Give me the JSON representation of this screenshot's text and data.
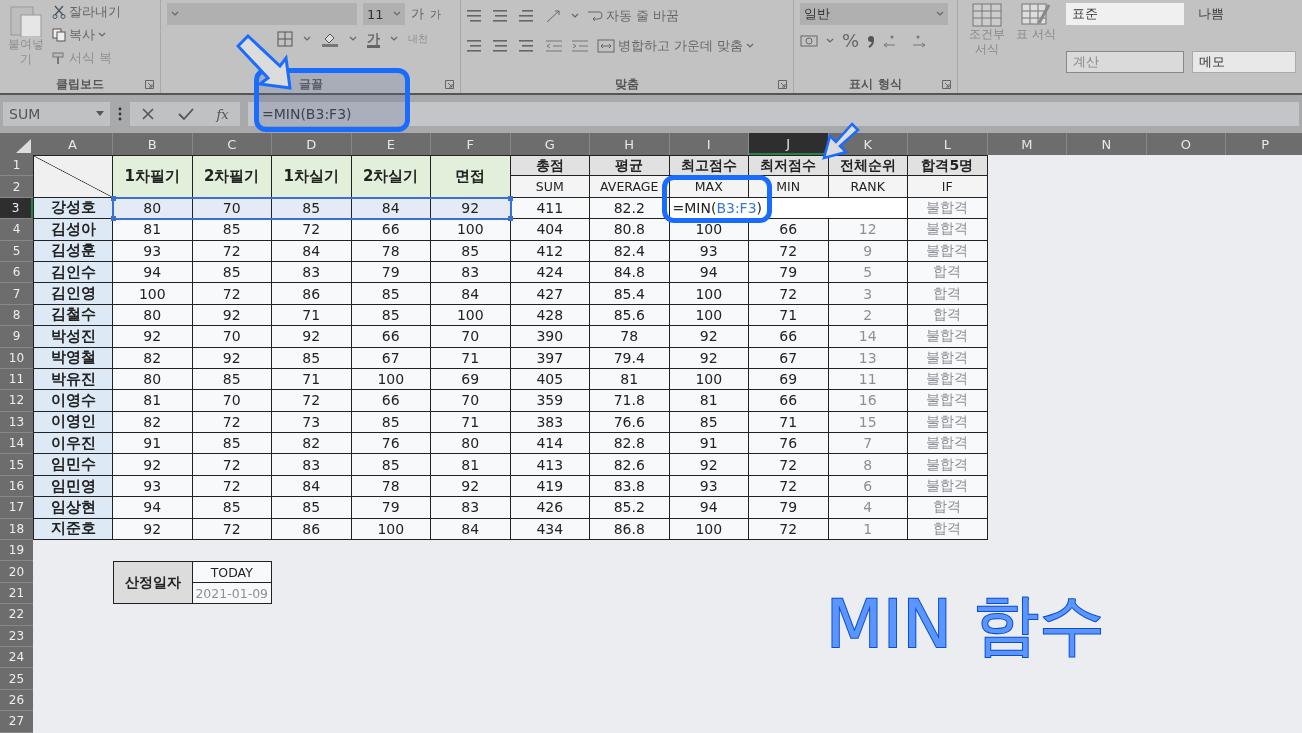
{
  "ribbon": {
    "clipboard": {
      "label": "클립보드",
      "paste": "붙여넣기",
      "cut": "잘라내기",
      "copy": "복사",
      "format_painter": "서식 복"
    },
    "font": {
      "label": "글꼴",
      "size": "11",
      "grow": "가",
      "shrink": "가",
      "font_color": "가",
      "phonetic": "내천"
    },
    "alignment": {
      "label": "맞춤",
      "wrap": "자동 줄 바꿈",
      "merge": "병합하고 가운데 맞춤"
    },
    "number": {
      "label": "표시 형식",
      "format": "일반",
      "percent": "%"
    },
    "styles": {
      "conditional": "조건부 서식",
      "table": "표 서식",
      "cell_styles": [
        {
          "label": "표준",
          "kind": "normal"
        },
        {
          "label": "나쁨",
          "kind": "bad"
        },
        {
          "label": "계산",
          "kind": "calculation"
        },
        {
          "label": "메모",
          "kind": "note"
        }
      ]
    }
  },
  "formula_bar": {
    "name_box": "SUM",
    "function_label": "fx",
    "formula": "=MIN(B3:F3)"
  },
  "columns": [
    {
      "label": "A",
      "selected": false
    },
    {
      "label": "B",
      "selected": false
    },
    {
      "label": "C",
      "selected": false
    },
    {
      "label": "D",
      "selected": false
    },
    {
      "label": "E",
      "selected": false
    },
    {
      "label": "F",
      "selected": false
    },
    {
      "label": "G",
      "selected": false
    },
    {
      "label": "H",
      "selected": false
    },
    {
      "label": "I",
      "selected": false
    },
    {
      "label": "J",
      "selected": true
    },
    {
      "label": "K",
      "selected": false
    },
    {
      "label": "L",
      "selected": false
    },
    {
      "label": "M",
      "selected": false
    },
    {
      "label": "N",
      "selected": false
    },
    {
      "label": "O",
      "selected": false
    },
    {
      "label": "P",
      "selected": false
    }
  ],
  "rows": [
    {
      "label": "1",
      "selected": false
    },
    {
      "label": "2",
      "selected": false
    },
    {
      "label": "3",
      "selected": true
    },
    {
      "label": "4",
      "selected": false
    },
    {
      "label": "5",
      "selected": false
    },
    {
      "label": "6",
      "selected": false
    },
    {
      "label": "7",
      "selected": false
    },
    {
      "label": "8",
      "selected": false
    },
    {
      "label": "9",
      "selected": false
    },
    {
      "label": "10",
      "selected": false
    },
    {
      "label": "11",
      "selected": false
    },
    {
      "label": "12",
      "selected": false
    },
    {
      "label": "13",
      "selected": false
    },
    {
      "label": "14",
      "selected": false
    },
    {
      "label": "15",
      "selected": false
    },
    {
      "label": "16",
      "selected": false
    },
    {
      "label": "17",
      "selected": false
    },
    {
      "label": "18",
      "selected": false
    },
    {
      "label": "19",
      "selected": false
    },
    {
      "label": "20",
      "selected": false
    },
    {
      "label": "21",
      "selected": false
    },
    {
      "label": "22",
      "selected": false
    },
    {
      "label": "23",
      "selected": false
    },
    {
      "label": "24",
      "selected": false
    },
    {
      "label": "25",
      "selected": false
    },
    {
      "label": "26",
      "selected": false
    },
    {
      "label": "27",
      "selected": false
    }
  ],
  "table": {
    "subjects": [
      "1차필기",
      "2차필기",
      "1차실기",
      "2차실기",
      "면접"
    ],
    "summary": [
      {
        "title": "총점",
        "function": "SUM"
      },
      {
        "title": "평균",
        "function": "AVERAGE"
      },
      {
        "title": "최고점수",
        "function": "MAX"
      },
      {
        "title": "최저점수",
        "function": "MIN"
      },
      {
        "title": "전체순위",
        "function": "RANK"
      },
      {
        "title": "합격5명",
        "function": "IF"
      }
    ],
    "records": [
      {
        "name": "강성호",
        "scores": [
          "80",
          "70",
          "85",
          "84",
          "92"
        ],
        "total": "411",
        "average": "82.2",
        "formula": {
          "prefix": "=MIN(",
          "reference": "B3:F3",
          "suffix": ")"
        },
        "result": "불합격"
      },
      {
        "name": "김성아",
        "scores": [
          "81",
          "85",
          "72",
          "66",
          "100"
        ],
        "total": "404",
        "average": "80.8",
        "max": "100",
        "min": "66",
        "rank": "12",
        "result": "불합격"
      },
      {
        "name": "김성훈",
        "scores": [
          "93",
          "72",
          "84",
          "78",
          "85"
        ],
        "total": "412",
        "average": "82.4",
        "max": "93",
        "min": "72",
        "rank": "9",
        "result": "불합격"
      },
      {
        "name": "김인수",
        "scores": [
          "94",
          "85",
          "83",
          "79",
          "83"
        ],
        "total": "424",
        "average": "84.8",
        "max": "94",
        "min": "79",
        "rank": "5",
        "result": "합격"
      },
      {
        "name": "김인영",
        "scores": [
          "100",
          "72",
          "86",
          "85",
          "84"
        ],
        "total": "427",
        "average": "85.4",
        "max": "100",
        "min": "72",
        "rank": "3",
        "result": "합격"
      },
      {
        "name": "김철수",
        "scores": [
          "80",
          "92",
          "71",
          "85",
          "100"
        ],
        "total": "428",
        "average": "85.6",
        "max": "100",
        "min": "71",
        "rank": "2",
        "result": "합격"
      },
      {
        "name": "박성진",
        "scores": [
          "92",
          "70",
          "92",
          "66",
          "70"
        ],
        "total": "390",
        "average": "78",
        "max": "92",
        "min": "66",
        "rank": "14",
        "result": "불합격"
      },
      {
        "name": "박영철",
        "scores": [
          "82",
          "92",
          "85",
          "67",
          "71"
        ],
        "total": "397",
        "average": "79.4",
        "max": "92",
        "min": "67",
        "rank": "13",
        "result": "불합격"
      },
      {
        "name": "박유진",
        "scores": [
          "80",
          "85",
          "71",
          "100",
          "69"
        ],
        "total": "405",
        "average": "81",
        "max": "100",
        "min": "69",
        "rank": "11",
        "result": "불합격"
      },
      {
        "name": "이영수",
        "scores": [
          "81",
          "70",
          "72",
          "66",
          "70"
        ],
        "total": "359",
        "average": "71.8",
        "max": "81",
        "min": "66",
        "rank": "16",
        "result": "불합격"
      },
      {
        "name": "이영인",
        "scores": [
          "82",
          "72",
          "73",
          "85",
          "71"
        ],
        "total": "383",
        "average": "76.6",
        "max": "85",
        "min": "71",
        "rank": "15",
        "result": "불합격"
      },
      {
        "name": "이우진",
        "scores": [
          "91",
          "85",
          "82",
          "76",
          "80"
        ],
        "total": "414",
        "average": "82.8",
        "max": "91",
        "min": "76",
        "rank": "7",
        "result": "불합격"
      },
      {
        "name": "임민수",
        "scores": [
          "92",
          "72",
          "83",
          "85",
          "81"
        ],
        "total": "413",
        "average": "82.6",
        "max": "92",
        "min": "72",
        "rank": "8",
        "result": "불합격"
      },
      {
        "name": "임민영",
        "scores": [
          "93",
          "72",
          "84",
          "78",
          "92"
        ],
        "total": "419",
        "average": "83.8",
        "max": "93",
        "min": "72",
        "rank": "6",
        "result": "불합격"
      },
      {
        "name": "임상현",
        "scores": [
          "94",
          "85",
          "85",
          "79",
          "83"
        ],
        "total": "426",
        "average": "85.2",
        "max": "94",
        "min": "79",
        "rank": "4",
        "result": "합격"
      },
      {
        "name": "지준호",
        "scores": [
          "92",
          "72",
          "86",
          "100",
          "84"
        ],
        "total": "434",
        "average": "86.8",
        "max": "100",
        "min": "72",
        "rank": "1",
        "result": "합격"
      }
    ]
  },
  "date_box": {
    "label": "산정일자",
    "function": "TODAY",
    "value": "2021-01-09"
  },
  "title": "MIN 함수"
}
